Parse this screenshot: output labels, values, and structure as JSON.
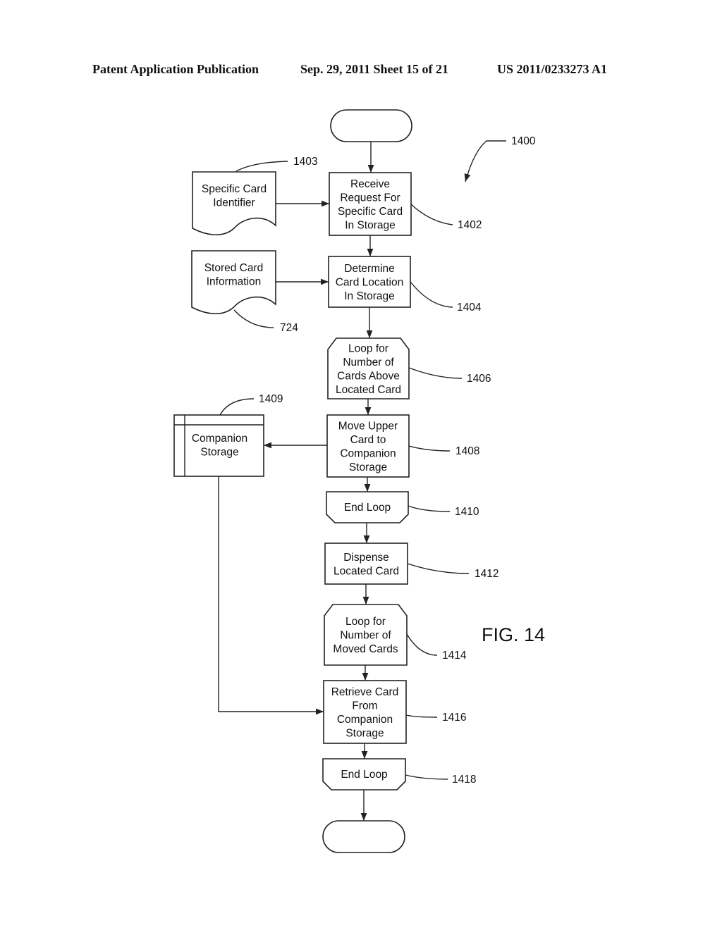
{
  "header": {
    "publication": "Patent Application Publication",
    "date_sheet": "Sep. 29, 2011   Sheet 15 of 21",
    "number": "US 2011/0233273 A1"
  },
  "figure": {
    "label": "FIG. 14",
    "ref": "1400",
    "nodes": {
      "start": {
        "type": "terminator",
        "lines": []
      },
      "n1402": {
        "type": "process",
        "ref": "1402",
        "lines": [
          "Receive",
          "Request For",
          "Specific Card",
          "In Storage"
        ]
      },
      "n1403": {
        "type": "document",
        "ref": "1403",
        "lines": [
          "Specific Card",
          "Identifier"
        ]
      },
      "n724": {
        "type": "document",
        "ref": "724",
        "lines": [
          "Stored Card",
          "Information"
        ]
      },
      "n1404": {
        "type": "process",
        "ref": "1404",
        "lines": [
          "Determine",
          "Card Location",
          "In Storage"
        ]
      },
      "n1406": {
        "type": "loop-start",
        "ref": "1406",
        "lines": [
          "Loop for",
          "Number of",
          "Cards Above",
          "Located Card"
        ]
      },
      "n1408": {
        "type": "process",
        "ref": "1408",
        "lines": [
          "Move Upper",
          "Card to",
          "Companion",
          "Storage"
        ]
      },
      "n1409": {
        "type": "internal-storage",
        "ref": "1409",
        "lines": [
          "Companion",
          "Storage"
        ]
      },
      "n1410": {
        "type": "loop-end",
        "ref": "1410",
        "lines": [
          "End Loop"
        ]
      },
      "n1412": {
        "type": "process",
        "ref": "1412",
        "lines": [
          "Dispense",
          "Located Card"
        ]
      },
      "n1414": {
        "type": "loop-start",
        "ref": "1414",
        "lines": [
          "Loop for",
          "Number of",
          "Moved Cards"
        ]
      },
      "n1416": {
        "type": "process",
        "ref": "1416",
        "lines": [
          "Retrieve Card",
          "From",
          "Companion",
          "Storage"
        ]
      },
      "n1418": {
        "type": "loop-end",
        "ref": "1418",
        "lines": [
          "End Loop"
        ]
      },
      "end": {
        "type": "terminator",
        "lines": []
      }
    },
    "edges": [
      [
        "start",
        "n1402"
      ],
      [
        "n1403",
        "n1402"
      ],
      [
        "n1402",
        "n1404"
      ],
      [
        "n724",
        "n1404"
      ],
      [
        "n1404",
        "n1406"
      ],
      [
        "n1406",
        "n1408"
      ],
      [
        "n1408",
        "n1409"
      ],
      [
        "n1408",
        "n1410"
      ],
      [
        "n1410",
        "n1412"
      ],
      [
        "n1412",
        "n1414"
      ],
      [
        "n1414",
        "n1416"
      ],
      [
        "n1409",
        "n1416"
      ],
      [
        "n1416",
        "n1418"
      ],
      [
        "n1418",
        "end"
      ]
    ]
  }
}
